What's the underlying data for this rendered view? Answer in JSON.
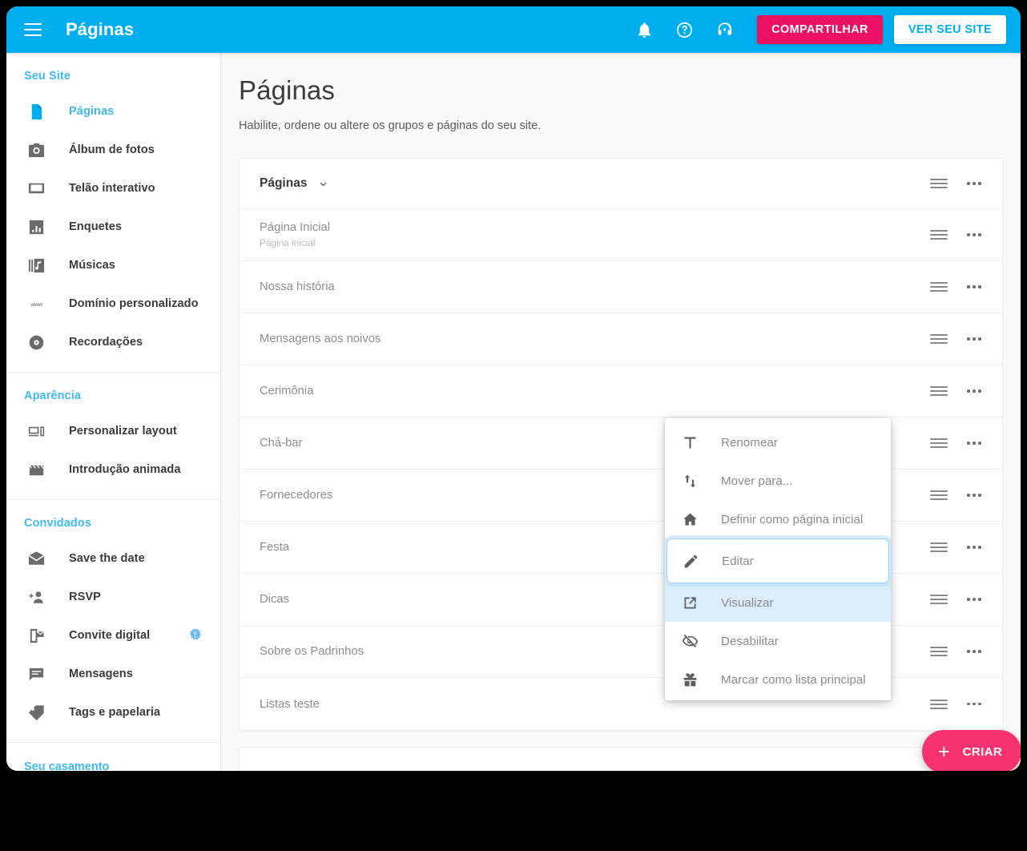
{
  "topbar": {
    "menu_icon": "hamburger-icon",
    "title": "Páginas",
    "icons": [
      {
        "name": "bell-icon"
      },
      {
        "name": "help-circle-icon"
      },
      {
        "name": "headset-support-icon"
      }
    ],
    "share_label": "COMPARTILHAR",
    "view_site_label": "VER SEU SITE",
    "bg_color": "#00AEEF",
    "share_color": "#ED1164"
  },
  "sidebar": {
    "sections": [
      {
        "header": "Seu Site",
        "items": [
          {
            "label": "Páginas",
            "icon": "document-icon",
            "active": true,
            "badge": false
          },
          {
            "label": "Álbum de fotos",
            "icon": "camera-icon",
            "active": false,
            "badge": false
          },
          {
            "label": "Telão interativo",
            "icon": "monitor-icon",
            "active": false,
            "badge": false
          },
          {
            "label": "Enquetes",
            "icon": "bar-chart-icon",
            "active": false,
            "badge": false
          },
          {
            "label": "Músicas",
            "icon": "music-library-icon",
            "active": false,
            "badge": false
          },
          {
            "label": "Domínio personalizado",
            "icon": "www-icon",
            "active": false,
            "badge": false
          },
          {
            "label": "Recordações",
            "icon": "disc-icon",
            "active": false,
            "badge": false
          }
        ]
      },
      {
        "header": "Aparência",
        "items": [
          {
            "label": "Personalizar layout",
            "icon": "devices-icon",
            "active": false,
            "badge": false
          },
          {
            "label": "Introdução animada",
            "icon": "clapperboard-icon",
            "active": false,
            "badge": false
          }
        ]
      },
      {
        "header": "Convidados",
        "items": [
          {
            "label": "Save the date",
            "icon": "envelope-icon",
            "active": false,
            "badge": false
          },
          {
            "label": "RSVP",
            "icon": "add-person-icon",
            "active": false,
            "badge": false
          },
          {
            "label": "Convite digital",
            "icon": "mobile-invite-icon",
            "active": false,
            "badge": true
          },
          {
            "label": "Mensagens",
            "icon": "chat-bubble-icon",
            "active": false,
            "badge": false
          },
          {
            "label": "Tags e papelaria",
            "icon": "tag-icon",
            "active": false,
            "badge": false
          }
        ]
      }
    ],
    "footer_label": "Seu casamento",
    "accent_color": "#3FB9F5"
  },
  "main": {
    "title": "Páginas",
    "subtitle": "Habilite, ordene ou altere os grupos e páginas do seu site.",
    "group": {
      "name": "Páginas",
      "chevron_icon": "chevron-down-icon",
      "drag_icon": "drag-handle-icon",
      "more_icon": "more-options-icon"
    },
    "rows": [
      {
        "name": "Página Inicial",
        "sub": "Página inicial"
      },
      {
        "name": "Nossa história",
        "sub": ""
      },
      {
        "name": "Mensagens aos noivos",
        "sub": ""
      },
      {
        "name": "Cerimônia",
        "sub": ""
      },
      {
        "name": "Chá-bar",
        "sub": ""
      },
      {
        "name": "Fornecedores",
        "sub": ""
      },
      {
        "name": "Festa",
        "sub": ""
      },
      {
        "name": "Dicas",
        "sub": ""
      },
      {
        "name": "Sobre os Padrinhos",
        "sub": ""
      },
      {
        "name": "Listas teste",
        "sub": ""
      }
    ]
  },
  "context_menu": {
    "items": [
      {
        "label": "Renomear",
        "icon": "text-format-icon",
        "state": "normal"
      },
      {
        "label": "Mover para...",
        "icon": "move-arrows-icon",
        "state": "normal"
      },
      {
        "label": "Definir como página inicial",
        "icon": "home-icon",
        "state": "normal"
      },
      {
        "label": "Editar",
        "icon": "pencil-icon",
        "state": "focused"
      },
      {
        "label": "Visualizar",
        "icon": "external-link-icon",
        "state": "highlighted"
      },
      {
        "label": "Desabilitar",
        "icon": "eye-off-icon",
        "state": "normal"
      },
      {
        "label": "Marcar como lista principal",
        "icon": "gift-box-icon",
        "state": "normal"
      }
    ],
    "focus_border_color": "#9ACEF2",
    "highlight_color": "#D9EDFB"
  },
  "fab": {
    "icon": "plus-icon",
    "label": "CRIAR",
    "color": "#F6336E"
  }
}
